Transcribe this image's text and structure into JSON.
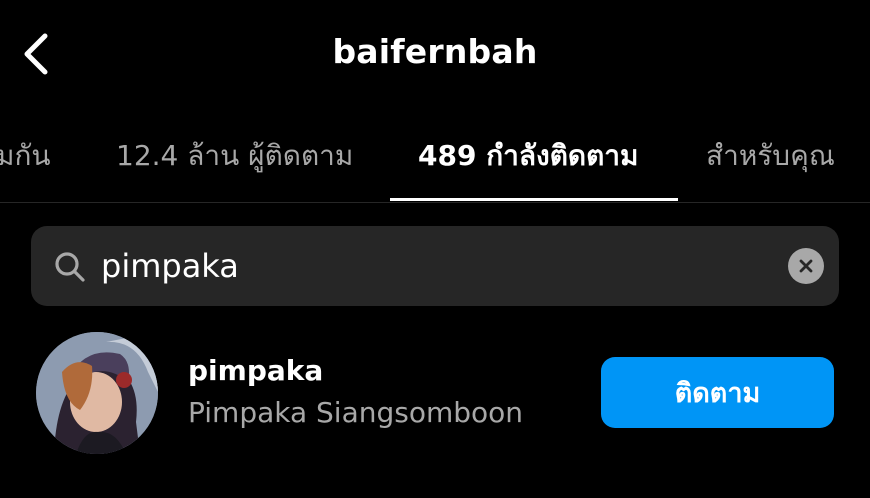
{
  "header": {
    "back_icon": "chevron-left-icon",
    "title": "baifernbah"
  },
  "tabs": [
    {
      "label": "มกัน",
      "active": false
    },
    {
      "label": "12.4 ล้าน ผู้ติดตาม",
      "active": false
    },
    {
      "label": "489 กำลังติดตาม",
      "active": true
    },
    {
      "label": "สำหรับคุณ",
      "active": false
    }
  ],
  "search": {
    "icon": "search-icon",
    "value": "pimpaka",
    "clear_icon": "close-icon"
  },
  "results": [
    {
      "username": "pimpaka",
      "full_name": "Pimpaka Siangsomboon",
      "button_label": "ติดตาม"
    }
  ],
  "colors": {
    "background": "#000000",
    "primary_text": "#ffffff",
    "secondary_text": "#a8a8a8",
    "search_bg": "#262626",
    "follow_button": "#0095f6"
  }
}
